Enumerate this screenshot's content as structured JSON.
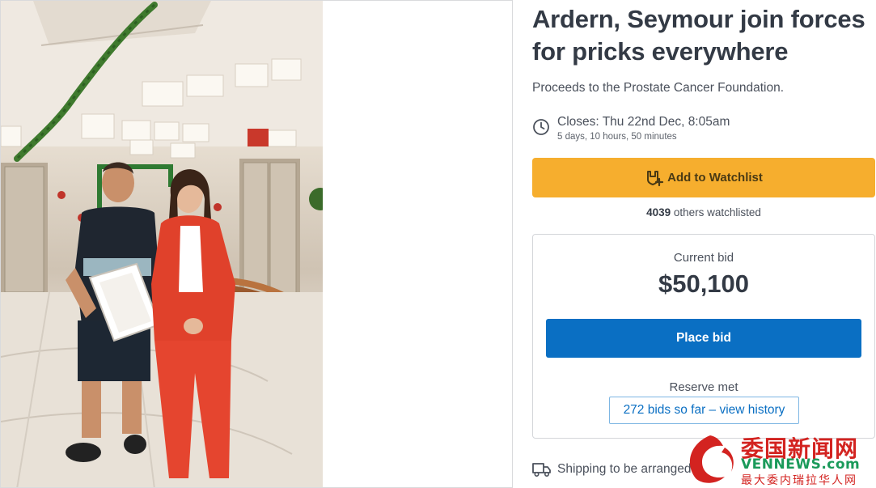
{
  "listing": {
    "title": "Ardern, Seymour join forces for pricks everywhere",
    "subtitle": "Proceeds to the Prostate Cancer Foundation.",
    "closes_label": "Closes: Thu 22nd Dec, 8:05am",
    "closes_remaining": "5 days, 10 hours, 50 minutes"
  },
  "watchlist": {
    "button_label": "Add to Watchlist",
    "count": "4039",
    "count_suffix": " others watchlisted",
    "icon": "watchlist-heart-plus-icon"
  },
  "bidding": {
    "current_bid_label": "Current bid",
    "current_bid_amount": "$50,100",
    "place_bid_label": "Place bid",
    "reserve_status": "Reserve met",
    "history_link": "272 bids so far – view history"
  },
  "shipping": {
    "text": "Shipping to be arranged",
    "icon": "truck-icon"
  },
  "watermark": {
    "title": "委国新闻网",
    "site": "VENNEWS.com",
    "tagline": "最大委内瑞拉华人网"
  },
  "colors": {
    "watchlist_button": "#f6ae2e",
    "place_bid_button": "#0a6fc3",
    "link": "#0a6fc3",
    "text": "#333a45",
    "watermark_red": "#d32320",
    "watermark_green": "#1a9a5a"
  }
}
